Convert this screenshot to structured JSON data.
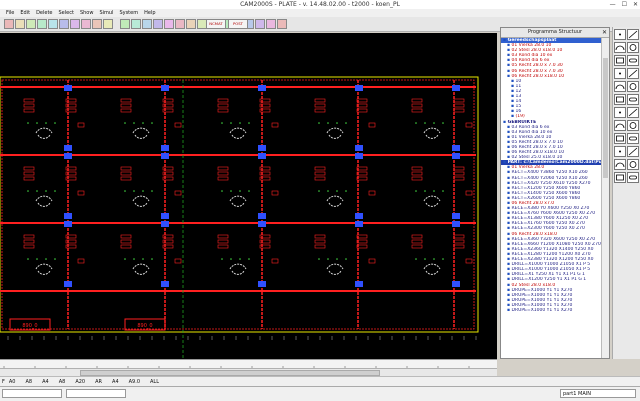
{
  "app": {
    "title": "CAM2000S  -  PLATE  -  v. 14.48.02.00  -  t2000 - koen_PL",
    "window_buttons": [
      "—",
      "☐",
      "✕"
    ]
  },
  "menu": [
    "File",
    "Edit",
    "Delete",
    "Select",
    "Show",
    "Simul",
    "System",
    "Help"
  ],
  "toolbar": {
    "icons": [
      "new-icon",
      "open-icon",
      "save-icon",
      "print-icon",
      "undo-icon",
      "cut-icon",
      "copy-icon",
      "paste-icon",
      "zoom-in-icon",
      "zoom-out-icon",
      "zoom-fit-icon",
      "pan-icon",
      "redraw-icon",
      "layer-icon",
      "grid-icon",
      "snap-icon",
      "measure-icon",
      "text-icon",
      "settings-icon",
      "run-icon",
      "stop-icon",
      "nc-icon",
      "tool-icon",
      "help-icon"
    ],
    "badge_1": "NCMAT",
    "badge_2": "POST"
  },
  "canvas": {
    "label_1": "890_0",
    "label_2": "890_0",
    "colors": {
      "background": "#000000",
      "outline_red": "#ff2020",
      "outline_yellow": "#e8e800",
      "part_blue": "#3050ff",
      "part_white": "#d8d8d8",
      "grid_green": "#20a020"
    }
  },
  "ruler": {
    "ticks": [
      "0",
      "200",
      "400",
      "600",
      "800",
      "1000",
      "1200",
      "1400",
      "1600",
      "1800",
      "2000",
      "2200",
      "2400",
      "2600",
      "2800",
      "3000"
    ]
  },
  "command_line": {
    "items": [
      "A0",
      "A8",
      "A4",
      "A8",
      "A20",
      "AR",
      "A4",
      "A9.0",
      "ALL"
    ],
    "prefix": "F"
  },
  "status": {
    "part": "part1 MAIN"
  },
  "panel": {
    "title": "Programma Structuur",
    "close": "✕",
    "tree": [
      {
        "text": "Gereedschapsplaat",
        "color": "#b00000",
        "indent": 0,
        "bold": true,
        "bg": "#3060d0"
      },
      {
        "text": "01 Vierka 28.0     10",
        "color": "#c00000",
        "indent": 2
      },
      {
        "text": "02 Stesl  28.0 x18.0     10",
        "color": "#c00000",
        "indent": 2
      },
      {
        "text": "03 Rond dia 10    ex",
        "color": "#c00000",
        "indent": 2
      },
      {
        "text": "04 Rond dia 6     ex",
        "color": "#c00000",
        "indent": 2
      },
      {
        "text": "05 Recht 28.0 x 7.0   30",
        "color": "#c00000",
        "indent": 2
      },
      {
        "text": "06 Recht 28.0 x 7.0   30",
        "color": "#c00000",
        "indent": 2
      },
      {
        "text": "06 Recht 28.0 x18.0   10",
        "color": "#c00000",
        "indent": 2
      },
      {
        "text": "10",
        "color": "#1a1a80",
        "indent": 4
      },
      {
        "text": "11",
        "color": "#1a1a80",
        "indent": 4
      },
      {
        "text": "12",
        "color": "#1a1a80",
        "indent": 4
      },
      {
        "text": "13",
        "color": "#1a1a80",
        "indent": 4
      },
      {
        "text": "14",
        "color": "#1a1a80",
        "indent": 4
      },
      {
        "text": "15",
        "color": "#1a1a80",
        "indent": 4
      },
      {
        "text": "16",
        "color": "#1a1a80",
        "indent": 4
      },
      {
        "text": "(19)",
        "color": "#c00000",
        "indent": 4
      },
      {
        "text": "GEBRUIKTE",
        "color": "#1a1a80",
        "indent": 0,
        "bold": true
      },
      {
        "text": "03 Rond dia 6    ex",
        "color": "#1a1a80",
        "indent": 2
      },
      {
        "text": "03 Rond dia 10   ex",
        "color": "#1a1a80",
        "indent": 2
      },
      {
        "text": "01 Vierka 28.0    10",
        "color": "#1a1a80",
        "indent": 2
      },
      {
        "text": "05 Recht 28.0 x 7.0  10",
        "color": "#1a1a80",
        "indent": 2
      },
      {
        "text": "06 Recht 28.0 x 7.0  10",
        "color": "#1a1a80",
        "indent": 2
      },
      {
        "text": "06 Recht 28.0 x18.0  10",
        "color": "#1a1a80",
        "indent": 2
      },
      {
        "text": "02 Stesl  25.0 x18.0  10",
        "color": "#1a1a80",
        "indent": 2
      },
      {
        "text": "PART: c:\\Camdemo\\Cam2000D.dat\\Pu",
        "color": "#ffffff",
        "indent": 0,
        "bold": true,
        "bg": "#2040b0"
      },
      {
        "text": "01 Vierka 28.0",
        "color": "#c00000",
        "indent": 2
      },
      {
        "text": "RECT=X400 Y3860 Y250 X10 Z60",
        "color": "#1a1a80",
        "indent": 2
      },
      {
        "text": "RECT=X400 Y2060 Y250 X10 Z60",
        "color": "#1a1a80",
        "indent": 2
      },
      {
        "text": "RECT=X420 Y250 X610 Y250 X270",
        "color": "#1a1a80",
        "indent": 2
      },
      {
        "text": "RECT=X1200 Y250 X600 Y860",
        "color": "#1a1a80",
        "indent": 2
      },
      {
        "text": "RECT=X1400 Y250 X600 Y860",
        "color": "#1a1a80",
        "indent": 2
      },
      {
        "text": "RECT=X2600 Y250 X600 Y860",
        "color": "#1a1a80",
        "indent": 2
      },
      {
        "text": "06 Recht 28.0 x7.0",
        "color": "#c00000",
        "indent": 2
      },
      {
        "text": "RECE=X380 Y0 X600 Y250 X0 Z70",
        "color": "#1a1a80",
        "indent": 2
      },
      {
        "text": "RECE=X760 Y600 X600 Y250 X0 Z70",
        "color": "#1a1a80",
        "indent": 2
      },
      {
        "text": "RECE=X1380 Y600 X1250 X0 Z70",
        "color": "#1a1a80",
        "indent": 2
      },
      {
        "text": "RECE=X1760 Y600 Y250 X0 Z70",
        "color": "#1a1a80",
        "indent": 2
      },
      {
        "text": "RECE=X2300 Y600 Y250 X0 Z70",
        "color": "#1a1a80",
        "indent": 2
      },
      {
        "text": "06 Recht 28.0 x18.0",
        "color": "#c00000",
        "indent": 2
      },
      {
        "text": "RECE=X360 Y320 X600 Y250 X0 Z70",
        "color": "#1a1a80",
        "indent": 2
      },
      {
        "text": "RECE=X660 Y1200 X1080 Y250 X0 Z70",
        "color": "#1a1a80",
        "indent": 2
      },
      {
        "text": "RECE=X2360 Y1320 X1400 Y250 X0",
        "color": "#1a1a80",
        "indent": 2
      },
      {
        "text": "RECE=X1280 Y1200 Y1200 X0 Z70",
        "color": "#1a1a80",
        "indent": 2
      },
      {
        "text": "RECE=X2380 Y1320 X1200 Y250 X0",
        "color": "#1a1a80",
        "indent": 2
      },
      {
        "text": "DRILL=X1000 Y1000 Z1050 X1 P 5",
        "color": "#1a1a80",
        "indent": 2
      },
      {
        "text": "DRILL=X1000 Y1000 Z1050 X1 P 5",
        "color": "#1a1a80",
        "indent": 2
      },
      {
        "text": "DRILL=X1 Y250 X1 Y1 X1 P1 G 1",
        "color": "#1a1a80",
        "indent": 2
      },
      {
        "text": "DRILL=X1200 Y250 Y1 X1 P1 G 1",
        "color": "#1a1a80",
        "indent": 2
      },
      {
        "text": "02 Stesl 28.0 x18.0",
        "color": "#c00000",
        "indent": 2
      },
      {
        "text": "DRUPE=X1000 Y1 Y1 X270",
        "color": "#1a1a80",
        "indent": 2
      },
      {
        "text": "DRUPE=X1000 Y1 Y1 X270",
        "color": "#1a1a80",
        "indent": 2
      },
      {
        "text": "DRUPE=X1000 Y1 Y1 X270",
        "color": "#1a1a80",
        "indent": 2
      },
      {
        "text": "DRUPE=X1000 Y1 Y1 X270",
        "color": "#1a1a80",
        "indent": 2
      },
      {
        "text": "DRUPE=X1000 Y1 Y1 X270",
        "color": "#1a1a80",
        "indent": 2
      }
    ]
  },
  "palette": {
    "icons": [
      "point-icon",
      "line-icon",
      "arc-icon",
      "circle-icon",
      "rect-icon",
      "slot-icon",
      "ellipse-icon",
      "polygon-icon",
      "spline-icon",
      "hole-icon",
      "array-icon",
      "mirror-icon",
      "rotate-icon",
      "move-icon",
      "copy-icon",
      "trim-icon",
      "extend-icon",
      "fillet-icon",
      "chamfer-icon",
      "offset-icon",
      "dim-icon",
      "text-icon",
      "nest-icon",
      "check-icon"
    ]
  }
}
